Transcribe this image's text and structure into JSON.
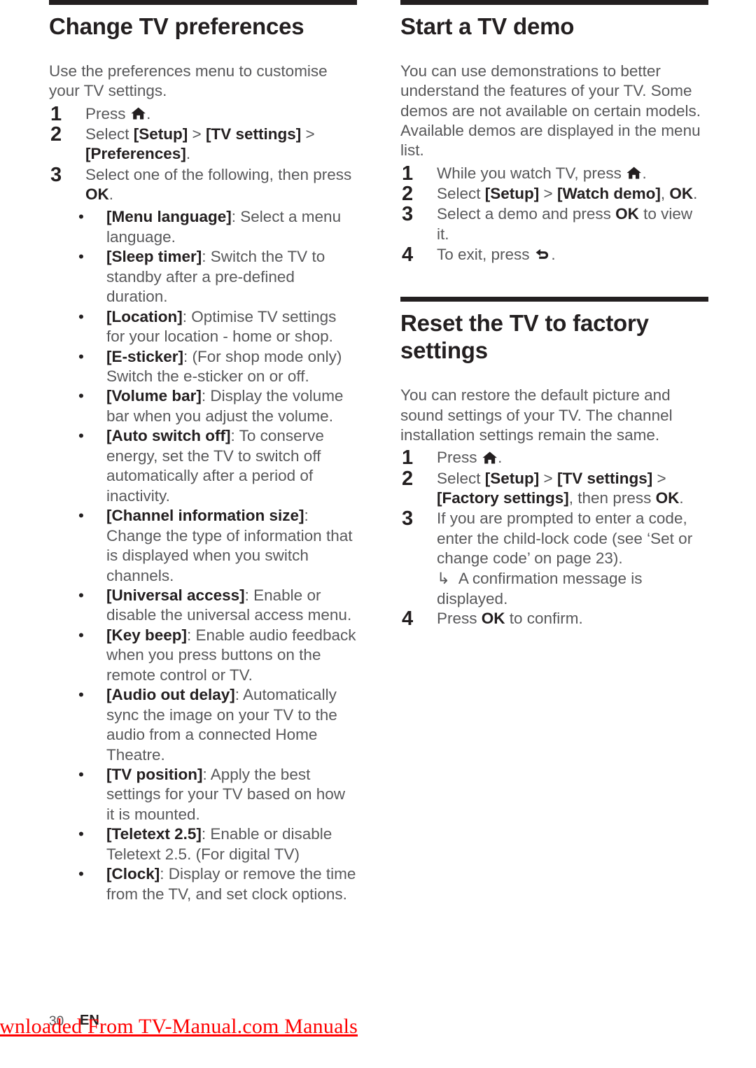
{
  "document": {
    "page_number": "30",
    "language_code": "EN",
    "watermark": "Downloaded From TV-Manual.com Manuals",
    "watermark_color": "#ff0000",
    "heading_color": "#231f20",
    "body_color": "#58585a"
  },
  "left_column": {
    "section": {
      "heading": "Change TV preferences",
      "intro": "Use the preferences menu to customise your TV settings.",
      "steps": [
        {
          "num": "1",
          "parts": [
            {
              "text": "Press ",
              "bold": false
            },
            {
              "icon": "home-icon"
            },
            {
              "text": ".",
              "bold": false
            }
          ]
        },
        {
          "num": "2",
          "parts": [
            {
              "text": "Select ",
              "bold": false
            },
            {
              "text": "[Setup]",
              "bold": true
            },
            {
              "text": " > ",
              "bold": false
            },
            {
              "text": "[TV settings]",
              "bold": true
            },
            {
              "text": " > ",
              "bold": false
            },
            {
              "text": "[Preferences]",
              "bold": true
            },
            {
              "text": ".",
              "bold": false
            }
          ]
        },
        {
          "num": "3",
          "parts": [
            {
              "text": "Select one of the following, then press ",
              "bold": false
            },
            {
              "text": "OK",
              "bold": true
            },
            {
              "text": ".",
              "bold": false
            }
          ]
        }
      ],
      "bullets": [
        {
          "term": "[Menu language]",
          "desc": ": Select a menu language."
        },
        {
          "term": "[Sleep timer]",
          "desc": ": Switch the TV to standby after a pre-defined duration."
        },
        {
          "term": "[Location]",
          "desc": ": Optimise TV settings for your location - home or shop."
        },
        {
          "term": "[E-sticker]",
          "desc": ": (For shop mode only) Switch the e-sticker on or off."
        },
        {
          "term": "[Volume bar]",
          "desc": ": Display the volume bar when you adjust the volume."
        },
        {
          "term": "[Auto switch off]",
          "desc": ": To conserve energy, set the TV to switch off automatically after a period of inactivity."
        },
        {
          "term": "[Channel information size]",
          "desc": ": Change the type of information that is displayed when you switch channels."
        },
        {
          "term": "[Universal access]",
          "desc": ": Enable or disable the universal access menu."
        },
        {
          "term": "[Key beep]",
          "desc": ": Enable audio feedback when you press buttons on the remote control or TV."
        },
        {
          "term": "[Audio out delay]",
          "desc": ": Automatically sync the image on your TV to the audio from a connected Home Theatre."
        },
        {
          "term": "[TV position]",
          "desc": ": Apply the best settings for your TV based on how it is mounted."
        },
        {
          "term": "[Teletext 2.5]",
          "desc": ": Enable or disable Teletext 2.5. (For digital TV)"
        },
        {
          "term": "[Clock]",
          "desc": ": Display or remove the time from the TV, and set clock options."
        }
      ]
    }
  },
  "right_column": {
    "section_demo": {
      "heading": "Start a TV demo",
      "intro": "You can use demonstrations to better understand the features of your TV. Some demos are not available on certain models. Available demos are displayed in the menu list.",
      "steps": [
        {
          "num": "1",
          "parts": [
            {
              "text": "While you watch TV, press ",
              "bold": false
            },
            {
              "icon": "home-icon"
            },
            {
              "text": ".",
              "bold": false
            }
          ]
        },
        {
          "num": "2",
          "parts": [
            {
              "text": "Select ",
              "bold": false
            },
            {
              "text": "[Setup]",
              "bold": true
            },
            {
              "text": " > ",
              "bold": false
            },
            {
              "text": "[Watch demo]",
              "bold": true
            },
            {
              "text": ", ",
              "bold": false
            },
            {
              "text": "OK",
              "bold": true
            },
            {
              "text": ".",
              "bold": false
            }
          ]
        },
        {
          "num": "3",
          "parts": [
            {
              "text": "Select a demo and press ",
              "bold": false
            },
            {
              "text": "OK",
              "bold": true
            },
            {
              "text": " to view it.",
              "bold": false
            }
          ]
        },
        {
          "num": "4",
          "parts": [
            {
              "text": "To exit, press ",
              "bold": false
            },
            {
              "icon": "back-icon"
            },
            {
              "text": ".",
              "bold": false
            }
          ]
        }
      ]
    },
    "section_reset": {
      "heading": "Reset the TV to factory settings",
      "intro": "You can restore the default picture and sound settings of your TV. The channel installation settings remain the same.",
      "steps": [
        {
          "num": "1",
          "parts": [
            {
              "text": "Press ",
              "bold": false
            },
            {
              "icon": "home-icon"
            },
            {
              "text": ".",
              "bold": false
            }
          ]
        },
        {
          "num": "2",
          "parts": [
            {
              "text": "Select ",
              "bold": false
            },
            {
              "text": "[Setup]",
              "bold": true
            },
            {
              "text": " > ",
              "bold": false
            },
            {
              "text": "[TV settings]",
              "bold": true
            },
            {
              "text": " > ",
              "bold": false
            },
            {
              "text": "[Factory settings]",
              "bold": true
            },
            {
              "text": ", then press ",
              "bold": false
            },
            {
              "text": "OK",
              "bold": true
            },
            {
              "text": ".",
              "bold": false
            }
          ]
        },
        {
          "num": "3",
          "parts": [
            {
              "text": "If you are prompted to enter a code, enter the child-lock code (see ‘Set or change code’ on page 23).",
              "bold": false
            }
          ],
          "substep": "A confirmation message is displayed."
        },
        {
          "num": "4",
          "parts": [
            {
              "text": "Press ",
              "bold": false
            },
            {
              "text": "OK",
              "bold": true
            },
            {
              "text": " to confirm.",
              "bold": false
            }
          ]
        }
      ]
    }
  }
}
